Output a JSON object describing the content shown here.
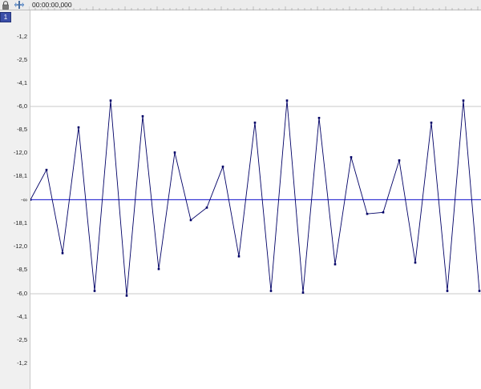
{
  "toolbar": {
    "lock_icon": "lock-icon",
    "snap_icon": "snap-icon",
    "timecode": "00:00:00,000"
  },
  "channel": {
    "label": "1"
  },
  "ruler": {
    "labels": [
      "-1,2",
      "-2,5",
      "-4,1",
      "-6,0",
      "-8,5",
      "-12,0",
      "-18,1",
      "-∞",
      "-18,1",
      "-12,0",
      "-8,5",
      "-6,0",
      "-4,1",
      "-2,5",
      "-1,2"
    ]
  },
  "colors": {
    "waveform": "#000066",
    "centerline": "#3a3ad6",
    "gridline": "#c8c8c8",
    "badge": "#3b4ea8"
  },
  "waveform": {
    "levels": [
      0.0,
      0.158,
      -0.283,
      0.383,
      -0.483,
      0.525,
      -0.508,
      0.442,
      -0.367,
      0.25,
      -0.108,
      -0.042,
      0.175,
      -0.3,
      0.408,
      -0.483,
      0.525,
      -0.492,
      0.433,
      -0.342,
      0.225,
      -0.075,
      -0.067,
      0.208,
      -0.333,
      0.408,
      -0.483,
      0.525,
      -0.483
    ]
  }
}
